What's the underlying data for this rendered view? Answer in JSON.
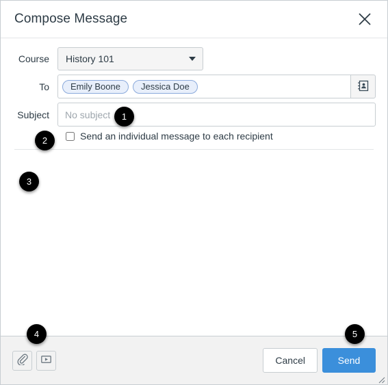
{
  "dialog": {
    "title": "Compose Message",
    "close_icon": "close-icon"
  },
  "form": {
    "course": {
      "label": "Course",
      "selected": "History 101",
      "options": [
        "History 101"
      ]
    },
    "to": {
      "label": "To",
      "recipients": [
        {
          "name": "Emily Boone"
        },
        {
          "name": "Jessica Doe"
        }
      ],
      "address_book_icon": "address-book-icon"
    },
    "subject": {
      "label": "Subject",
      "value": "",
      "placeholder": "No subject"
    },
    "individual_message": {
      "label": "Send an individual message to each recipient",
      "checked": false
    }
  },
  "body": {
    "value": "",
    "placeholder": ""
  },
  "footer": {
    "attach_file_icon": "paperclip-icon",
    "record_media_icon": "media-recorder-icon",
    "cancel_label": "Cancel",
    "send_label": "Send",
    "resize_icon": "resize-grip-icon"
  },
  "callouts": [
    {
      "number": "1"
    },
    {
      "number": "2"
    },
    {
      "number": "3"
    },
    {
      "number": "4"
    },
    {
      "number": "5"
    }
  ],
  "colors": {
    "send_button": "#3B8FDB",
    "pill_fill": "#E8EFFB",
    "pill_border": "#8AA9DB",
    "text": "#2D3B45",
    "border": "#C7CDD1",
    "footer_bg": "#F2F2F2",
    "badge_bg": "#000000"
  }
}
